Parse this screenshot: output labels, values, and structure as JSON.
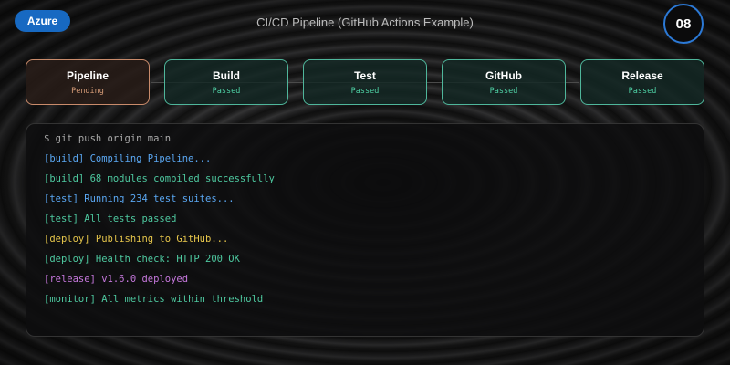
{
  "header": {
    "badge": "Azure",
    "title": "CI/CD Pipeline (GitHub Actions Example)",
    "slide_number": "08"
  },
  "pipeline": {
    "stages": [
      {
        "name": "Pipeline",
        "status": "Pending"
      },
      {
        "name": "Build",
        "status": "Passed"
      },
      {
        "name": "Test",
        "status": "Passed"
      },
      {
        "name": "GitHub",
        "status": "Passed"
      },
      {
        "name": "Release",
        "status": "Passed"
      }
    ]
  },
  "terminal": {
    "command": "$ git push origin main",
    "lines": [
      "[build] Compiling Pipeline...",
      "[build] 68 modules compiled successfully",
      "[test] Running 234 test suites...",
      "[test] All tests passed",
      "[deploy] Publishing to GitHub...",
      "[deploy] Health check: HTTP 200 OK",
      "[release] v1.6.0 deployed",
      "[monitor] All metrics within threshold"
    ]
  },
  "colors": {
    "accent": "#1769c2",
    "passed": "#4fd1a5",
    "pending": "#d49a76",
    "info": "#5aa7f2",
    "success": "#4ec9a0",
    "warning": "#e5c54b",
    "release": "#c678dd"
  }
}
